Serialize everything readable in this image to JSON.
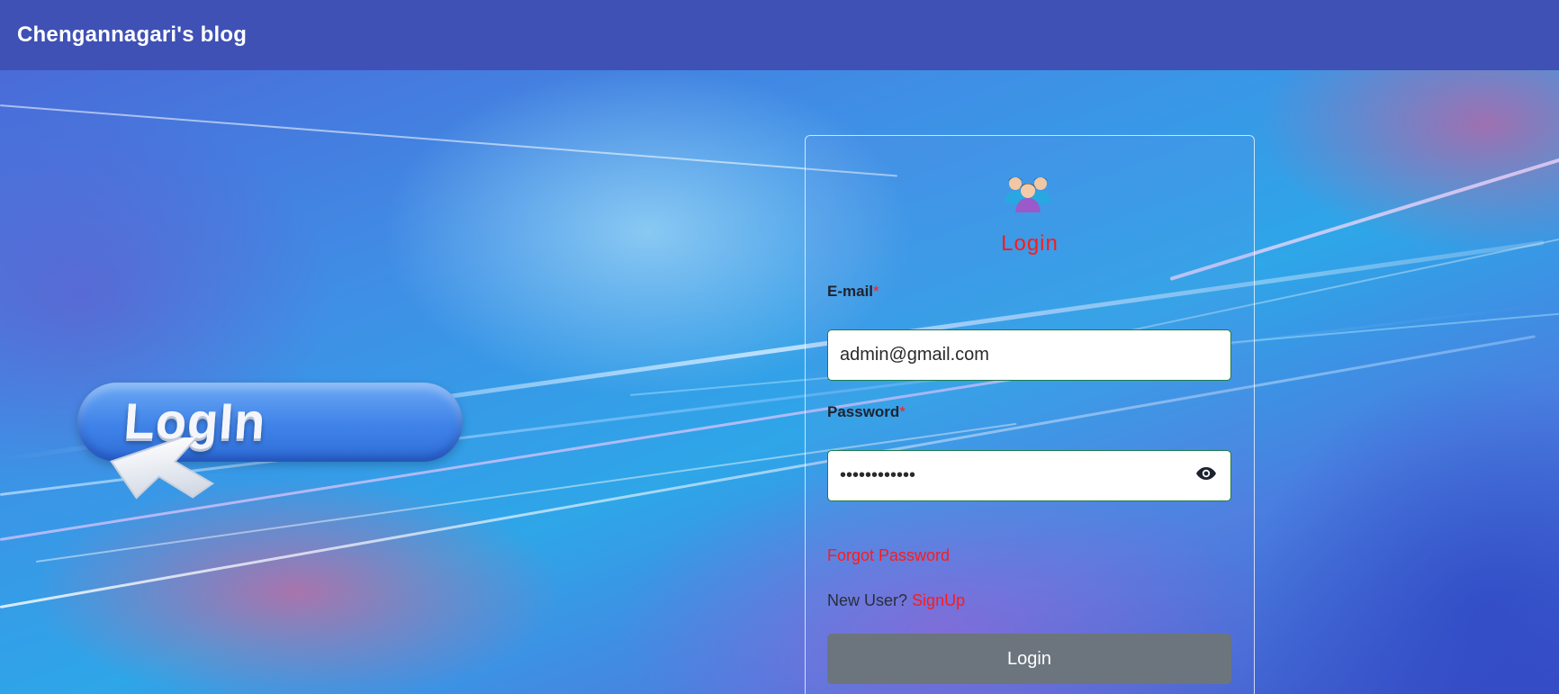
{
  "header": {
    "brand": "Chengannagari's blog"
  },
  "illustration": {
    "text": "LogIn"
  },
  "form": {
    "title": "Login",
    "email_label": "E-mail",
    "email_required": "*",
    "email_value": "admin@gmail.com",
    "password_label": "Password",
    "password_required": "*",
    "password_value": "••••••••••••",
    "forgot_password": "Forgot Password",
    "new_user_text": "New User?",
    "signup_link": "SignUp",
    "login_button": "Login"
  },
  "colors": {
    "navbar": "#3f51b5",
    "accent_red": "#ff1a1a",
    "input_border": "#1f7a4a",
    "button": "#6c757d"
  },
  "icons": {
    "avatar": "users-group-icon",
    "eye": "eye-icon",
    "cursor": "cursor-arrow-icon"
  }
}
